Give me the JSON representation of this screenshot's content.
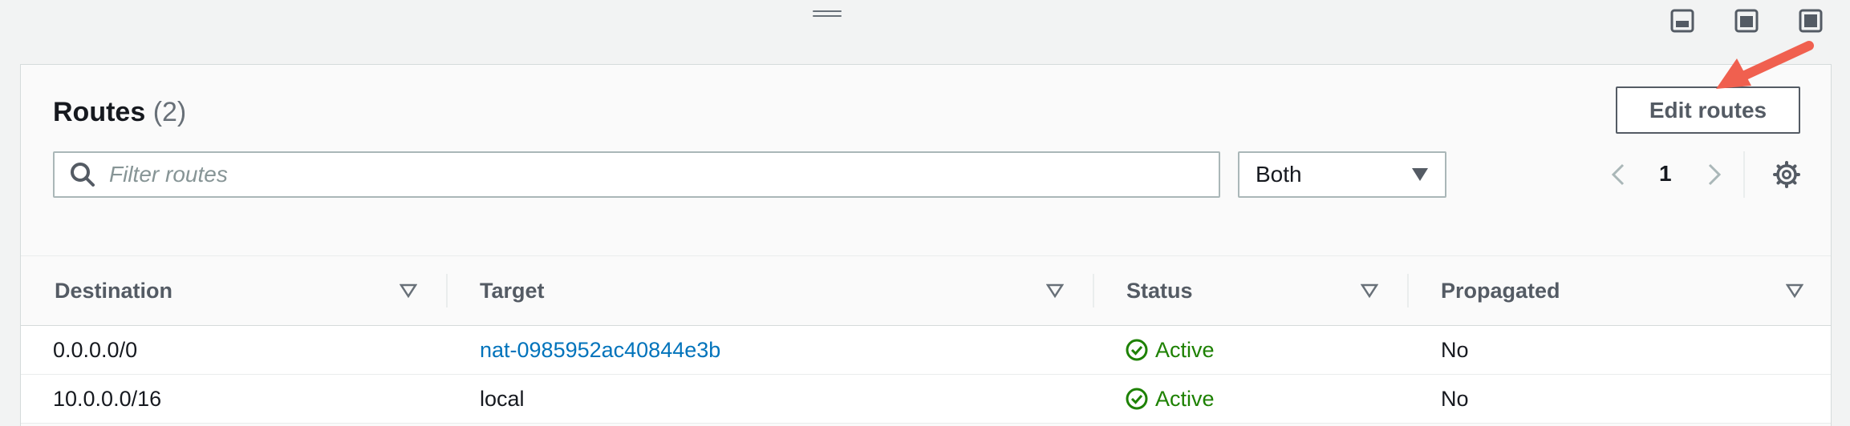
{
  "panel": {
    "title": "Routes",
    "count": "(2)",
    "edit_button": "Edit routes",
    "filter_placeholder": "Filter routes",
    "select_value": "Both",
    "page_number": "1"
  },
  "table": {
    "columns": [
      "Destination",
      "Target",
      "Status",
      "Propagated"
    ],
    "rows": [
      {
        "destination": "0.0.0.0/0",
        "target": "nat-0985952ac40844e3b",
        "status": "Active",
        "propagated": "No"
      },
      {
        "destination": "10.0.0.0/16",
        "target": "local",
        "status": "Active",
        "propagated": "No"
      }
    ]
  },
  "colors": {
    "link": "#0073bb",
    "success": "#1d8102",
    "annotation_arrow": "#f0604f"
  },
  "icons": [
    "drag-handle-icon",
    "layout-bottom-icon",
    "layout-side-icon",
    "layout-full-icon",
    "search-icon",
    "caret-down-icon",
    "chevron-left-icon",
    "chevron-right-icon",
    "gear-icon",
    "sort-icon",
    "status-check-icon",
    "annotation-arrow"
  ]
}
